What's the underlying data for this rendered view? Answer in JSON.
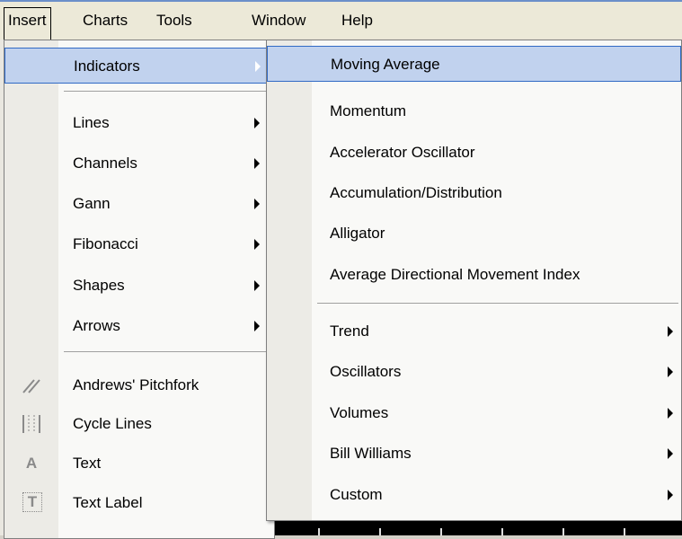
{
  "menubar": {
    "items": [
      "Insert",
      "Charts",
      "Tools",
      "Window",
      "Help"
    ]
  },
  "insert_menu": {
    "items": [
      {
        "label": "Indicators",
        "submenu": true,
        "highlighted": true
      },
      {
        "label": "Lines",
        "submenu": true
      },
      {
        "label": "Channels",
        "submenu": true
      },
      {
        "label": "Gann",
        "submenu": true
      },
      {
        "label": "Fibonacci",
        "submenu": true
      },
      {
        "label": "Shapes",
        "submenu": true
      },
      {
        "label": "Arrows",
        "submenu": true
      },
      {
        "label": "Andrews' Pitchfork",
        "icon": "pitchfork-icon"
      },
      {
        "label": "Cycle Lines",
        "icon": "cycle-lines-icon"
      },
      {
        "label": "Text",
        "icon": "text-icon",
        "icon_glyph": "A"
      },
      {
        "label": "Text Label",
        "icon": "text-label-icon",
        "icon_glyph": "T"
      }
    ]
  },
  "indicators_submenu": {
    "items": [
      {
        "label": "Moving Average",
        "highlighted": true
      },
      {
        "label": "Momentum"
      },
      {
        "label": "Accelerator Oscillator"
      },
      {
        "label": "Accumulation/Distribution"
      },
      {
        "label": "Alligator"
      },
      {
        "label": "Average Directional Movement Index"
      },
      {
        "label": "Trend",
        "submenu": true
      },
      {
        "label": "Oscillators",
        "submenu": true
      },
      {
        "label": "Volumes",
        "submenu": true
      },
      {
        "label": "Bill Williams",
        "submenu": true
      },
      {
        "label": "Custom",
        "submenu": true
      }
    ]
  },
  "colors": {
    "highlight_fill": "#c1d2ee",
    "highlight_border": "#316ac5",
    "menu_bg": "#f9f9f7",
    "gutter_bg": "#ecebe6"
  }
}
